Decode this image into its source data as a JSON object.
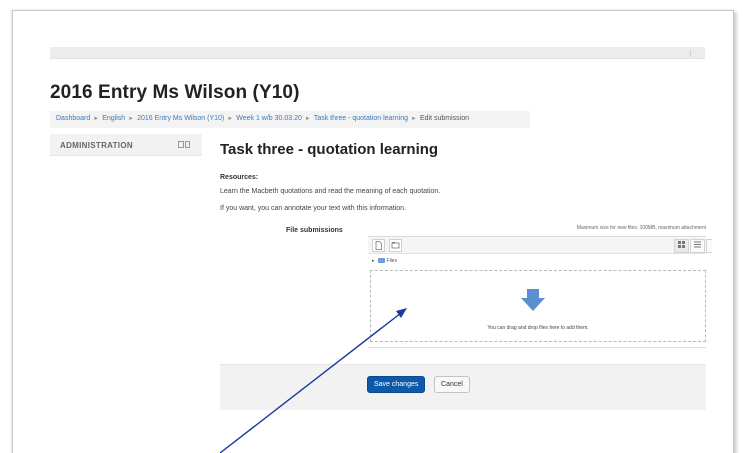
{
  "course": {
    "title": "2016 Entry Ms Wilson (Y10)"
  },
  "breadcrumb": [
    {
      "label": "Dashboard"
    },
    {
      "label": "English"
    },
    {
      "label": "2016 Entry Ms Wilson (Y10)"
    },
    {
      "label": "Week 1 w/b 30.03.20"
    },
    {
      "label": "Task three - quotation learning"
    },
    {
      "label": "Edit submission"
    }
  ],
  "breadcrumb_separator": "►",
  "sidebar": {
    "admin_title": "ADMINISTRATION",
    "dock_icon": "dock-icon"
  },
  "main": {
    "heading": "Task three - quotation learning",
    "resources_label": "Resources:",
    "resources_line1": "Learn the Macbeth quotations and read the meaning of each quotation.",
    "resources_line2": "If you want, you can annotate your text with this information."
  },
  "file_submissions": {
    "label": "File submissions",
    "max_size_text": "Maximum size for new files: 100MB, maximum attachment",
    "path_label": "Files",
    "dropzone_text": "You can drag and drop files here to add them.",
    "toolbar_icons": [
      "add-file-icon",
      "create-folder-icon",
      "grid-view-icon",
      "list-view-icon",
      "tree-view-icon"
    ]
  },
  "buttons": {
    "save_label": "Save changes",
    "cancel_label": "Cancel"
  },
  "colors": {
    "link": "#3a7bbf",
    "primary_button": "#0f5aa8",
    "upload_arrow": "#5b8fd1",
    "annotation_line": "#1a3a9e"
  }
}
